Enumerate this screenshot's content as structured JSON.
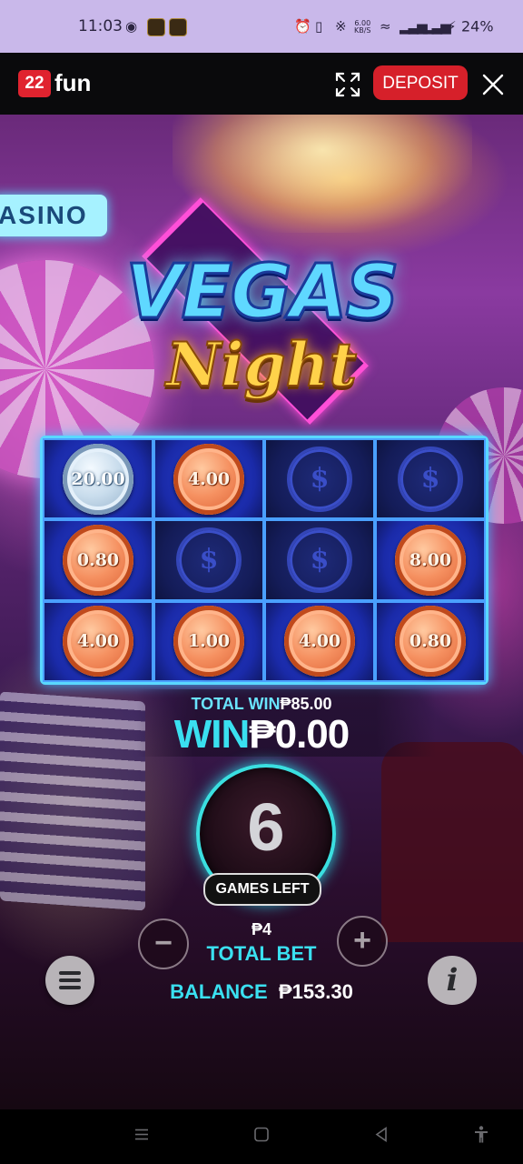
{
  "status_bar": {
    "time": "11:03",
    "net_speed_top": "6.00",
    "net_speed_unit": "KB/S",
    "battery": "24%"
  },
  "app_bar": {
    "logo_badge": "22",
    "logo_text": "fun",
    "deposit_label": "DEPOSIT",
    "icons": [
      "fullscreen-icon",
      "close-icon"
    ]
  },
  "game": {
    "title_line1": "VEGAS",
    "title_line2": "Night",
    "background_sign": "ASINO",
    "grid": [
      {
        "value": "20.00",
        "type": "silver"
      },
      {
        "value": "4.00",
        "type": "copper"
      },
      {
        "value": "$",
        "type": "empty"
      },
      {
        "value": "$",
        "type": "empty"
      },
      {
        "value": "0.80",
        "type": "copper"
      },
      {
        "value": "$",
        "type": "empty"
      },
      {
        "value": "$",
        "type": "empty"
      },
      {
        "value": "8.00",
        "type": "copper"
      },
      {
        "value": "4.00",
        "type": "copper"
      },
      {
        "value": "1.00",
        "type": "copper"
      },
      {
        "value": "4.00",
        "type": "copper"
      },
      {
        "value": "0.80",
        "type": "copper"
      }
    ],
    "total_win_label": "TOTAL WIN",
    "total_win_amount": "₱85.00",
    "win_label": "WIN",
    "win_amount": "₱0.00",
    "games_left_count": "6",
    "games_left_label": "GAMES LEFT",
    "bet_amount": "₱4",
    "bet_label": "TOTAL BET",
    "minus_symbol": "−",
    "plus_symbol": "+",
    "balance_label": "BALANCE",
    "balance_amount": "₱153.30",
    "info_symbol": "i"
  },
  "colors": {
    "accent_cyan": "#3ae0f0",
    "deposit_red": "#d6202a",
    "status_bar_bg": "#c9b8ea"
  }
}
